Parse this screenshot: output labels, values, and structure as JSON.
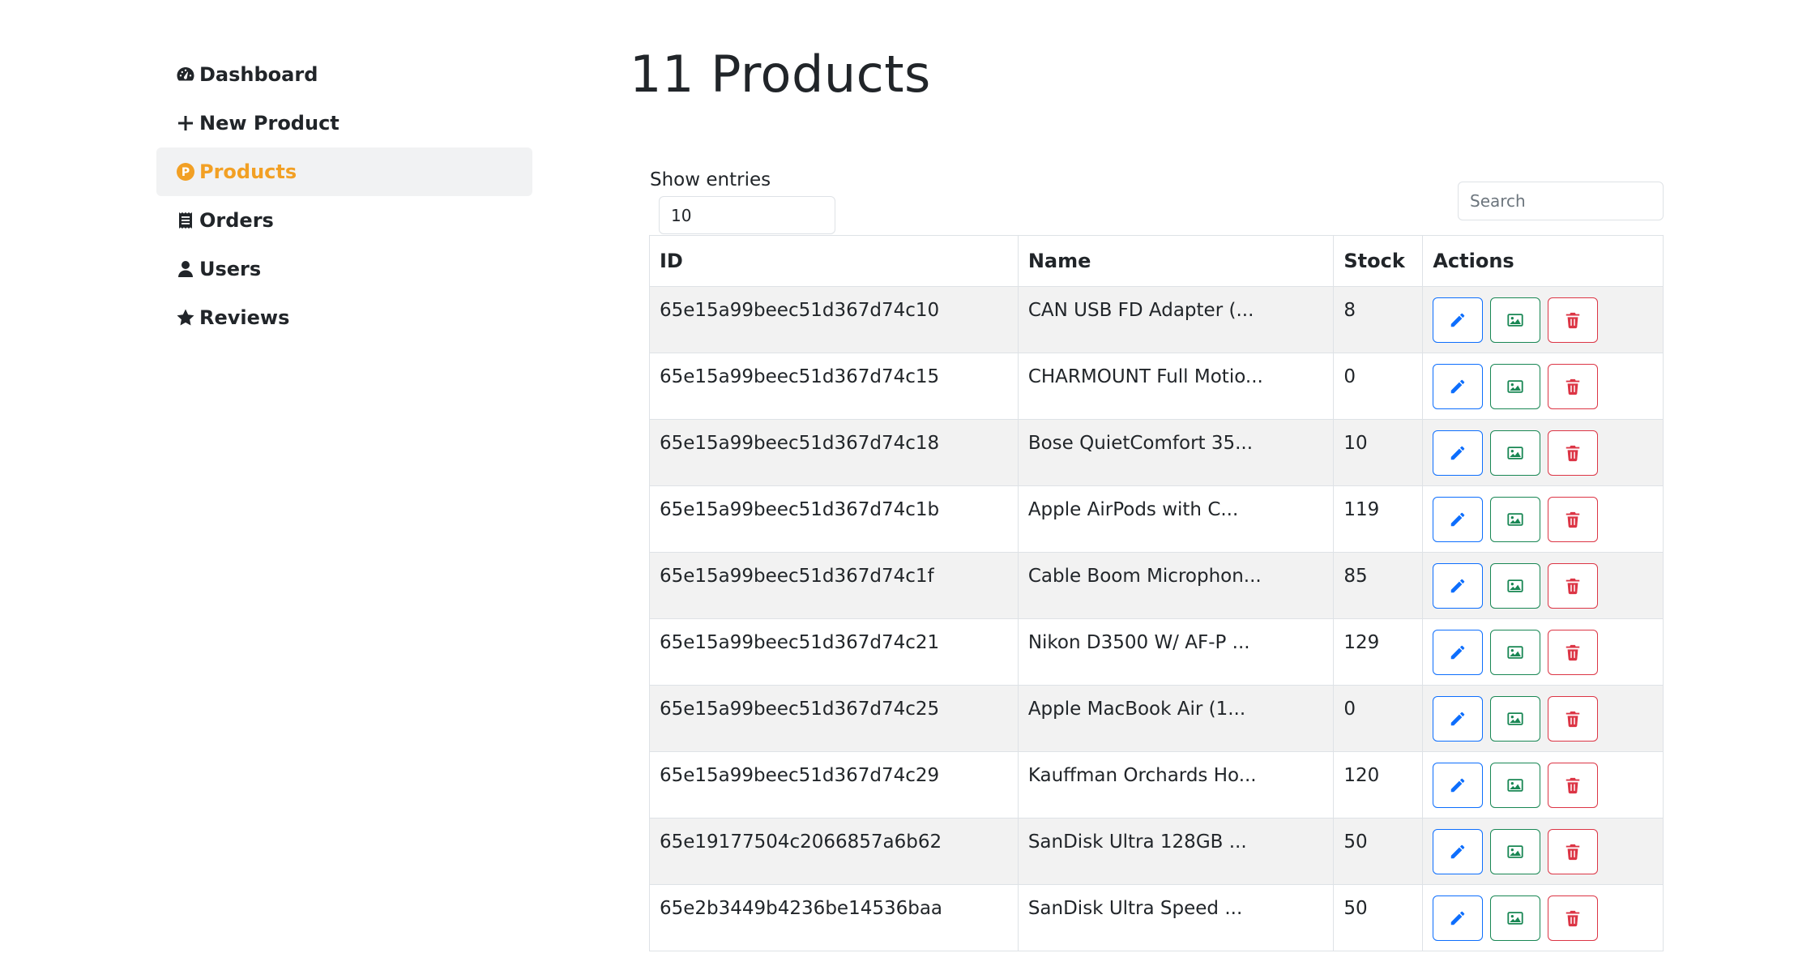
{
  "sidebar": {
    "items": [
      {
        "label": "Dashboard",
        "icon": "gauge-icon",
        "active": false
      },
      {
        "label": "New Product",
        "icon": "plus-icon",
        "active": false
      },
      {
        "label": "Products",
        "icon": "product-p-icon",
        "active": true
      },
      {
        "label": "Orders",
        "icon": "receipt-icon",
        "active": false
      },
      {
        "label": "Users",
        "icon": "user-icon",
        "active": false
      },
      {
        "label": "Reviews",
        "icon": "star-icon",
        "active": false
      }
    ]
  },
  "main": {
    "title": "11 Products",
    "show_entries_label": "Show entries",
    "show_entries_value": "10",
    "search_placeholder": "Search"
  },
  "table": {
    "headers": {
      "id": "ID",
      "name": "Name",
      "stock": "Stock",
      "actions": "Actions"
    },
    "rows": [
      {
        "id": "65e15a99beec51d367d74c10",
        "name": "CAN USB FD Adapter (...",
        "stock": "8"
      },
      {
        "id": "65e15a99beec51d367d74c15",
        "name": "CHARMOUNT Full Motio...",
        "stock": "0"
      },
      {
        "id": "65e15a99beec51d367d74c18",
        "name": "Bose QuietComfort 35...",
        "stock": "10"
      },
      {
        "id": "65e15a99beec51d367d74c1b",
        "name": "Apple AirPods with C...",
        "stock": "119"
      },
      {
        "id": "65e15a99beec51d367d74c1f",
        "name": "Cable Boom Microphon...",
        "stock": "85"
      },
      {
        "id": "65e15a99beec51d367d74c21",
        "name": "Nikon D3500 W/ AF-P ...",
        "stock": "129"
      },
      {
        "id": "65e15a99beec51d367d74c25",
        "name": "Apple MacBook Air (1...",
        "stock": "0"
      },
      {
        "id": "65e15a99beec51d367d74c29",
        "name": "Kauffman Orchards Ho...",
        "stock": "120"
      },
      {
        "id": "65e19177504c2066857a6b62",
        "name": "SanDisk Ultra 128GB ...",
        "stock": "50"
      },
      {
        "id": "65e2b3449b4236be14536baa",
        "name": "SanDisk Ultra Speed ...",
        "stock": "50"
      }
    ]
  },
  "colors": {
    "active_nav": "#f2a024",
    "edit": "#0d6efd",
    "image": "#198754",
    "delete": "#dc3545",
    "stripe": "#f2f2f2"
  }
}
